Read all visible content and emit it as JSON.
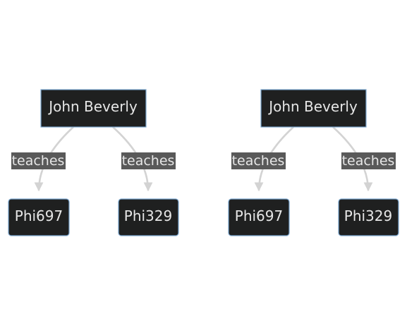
{
  "diagrams": [
    {
      "root": {
        "label": "John Beverly"
      },
      "edges": [
        {
          "label": "teaches",
          "target": "Phi697"
        },
        {
          "label": "teaches",
          "target": "Phi329"
        }
      ]
    },
    {
      "root": {
        "label": "John Beverly"
      },
      "edges": [
        {
          "label": "teaches",
          "target": "Phi697"
        },
        {
          "label": "teaches",
          "target": "Phi329"
        }
      ]
    }
  ],
  "colors": {
    "node_fill": "#1f2020",
    "node_border": "#7aa6cf",
    "node_text": "#e6e6e6",
    "edge": "#d3d3d3",
    "edge_label_bg": "#595959"
  }
}
